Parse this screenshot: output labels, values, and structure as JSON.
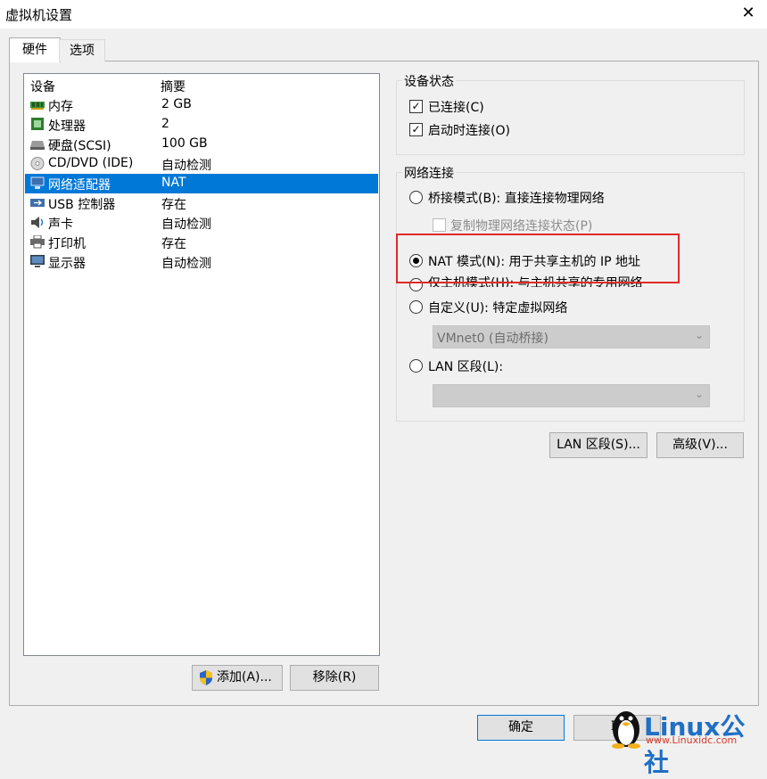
{
  "window": {
    "title": "虚拟机设置",
    "close_icon": "close-icon"
  },
  "tabs": [
    {
      "label": "硬件"
    },
    {
      "label": "选项"
    }
  ],
  "device_list": {
    "headers": {
      "device": "设备",
      "summary": "摘要"
    },
    "rows": [
      {
        "name": "内存",
        "summary": "2 GB",
        "icon": "memory-icon"
      },
      {
        "name": "处理器",
        "summary": "2",
        "icon": "processor-icon"
      },
      {
        "name": "硬盘(SCSI)",
        "summary": "100 GB",
        "icon": "hard-disk-icon"
      },
      {
        "name": "CD/DVD (IDE)",
        "summary": "自动检测",
        "icon": "cd-dvd-icon"
      },
      {
        "name": "网络适配器",
        "summary": "NAT",
        "icon": "network-adapter-icon",
        "selected": true
      },
      {
        "name": "USB 控制器",
        "summary": "存在",
        "icon": "usb-icon"
      },
      {
        "name": "声卡",
        "summary": "自动检测",
        "icon": "sound-icon"
      },
      {
        "name": "打印机",
        "summary": "存在",
        "icon": "printer-icon"
      },
      {
        "name": "显示器",
        "summary": "自动检测",
        "icon": "display-icon"
      }
    ]
  },
  "list_buttons": {
    "add": "添加(A)...",
    "remove": "移除(R)"
  },
  "device_status": {
    "title": "设备状态",
    "connected": {
      "label": "已连接(C)",
      "checked": true
    },
    "connect_at_power_on": {
      "label": "启动时连接(O)",
      "checked": true
    }
  },
  "network": {
    "title": "网络连接",
    "bridged": {
      "label": "桥接模式(B): 直接连接物理网络",
      "checked": false
    },
    "replicate": {
      "label": "复制物理网络连接状态(P)",
      "checked": false
    },
    "nat": {
      "label": "NAT 模式(N): 用于共享主机的 IP 地址",
      "checked": true
    },
    "host_only": {
      "label": "仅主机模式(H): 与主机共享的专用网络",
      "checked": false
    },
    "custom": {
      "label": "自定义(U): 特定虚拟网络",
      "checked": false
    },
    "custom_select": "VMnet0 (自动桥接)",
    "lan_segment": {
      "label": "LAN 区段(L):",
      "checked": false
    },
    "lan_select": ""
  },
  "side_buttons": {
    "lan_segments": "LAN 区段(S)...",
    "advanced": "高级(V)..."
  },
  "footer": {
    "ok": "确定",
    "cancel": "取"
  },
  "watermark": {
    "brand": "Linux公社",
    "url": "www.Linuxidc.com"
  },
  "colors": {
    "selection": "#0078d7",
    "highlight_box": "#e02a2a"
  }
}
